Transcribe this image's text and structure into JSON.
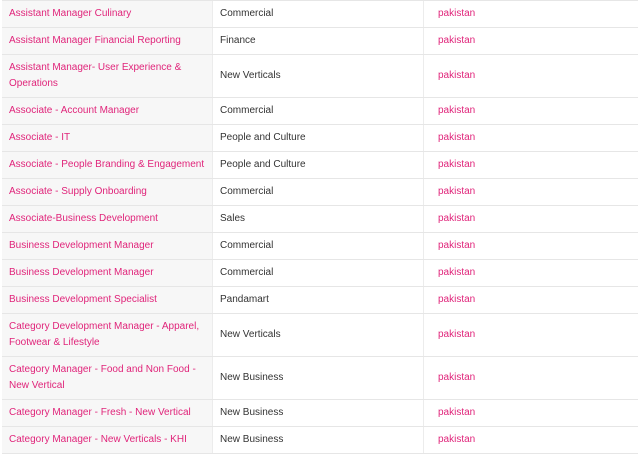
{
  "jobs": [
    {
      "title": "Assistant Manager Culinary",
      "department": "Commercial",
      "location": "pakistan"
    },
    {
      "title": "Assistant Manager Financial Reporting",
      "department": "Finance",
      "location": "pakistan"
    },
    {
      "title": "Assistant Manager- User Experience & Operations",
      "department": "New Verticals",
      "location": "pakistan"
    },
    {
      "title": "Associate - Account Manager",
      "department": "Commercial",
      "location": "pakistan"
    },
    {
      "title": "Associate - IT",
      "department": "People and Culture",
      "location": "pakistan"
    },
    {
      "title": "Associate - People Branding & Engagement",
      "department": "People and Culture",
      "location": "pakistan"
    },
    {
      "title": "Associate - Supply Onboarding",
      "department": "Commercial",
      "location": "pakistan"
    },
    {
      "title": "Associate-Business Development",
      "department": "Sales",
      "location": "pakistan"
    },
    {
      "title": "Business Development Manager",
      "department": "Commercial",
      "location": "pakistan"
    },
    {
      "title": "Business Development Manager",
      "department": "Commercial",
      "location": "pakistan"
    },
    {
      "title": "Business Development Specialist",
      "department": "Pandamart",
      "location": "pakistan"
    },
    {
      "title": "Category Development Manager - Apparel, Footwear & Lifestyle",
      "department": "New Verticals",
      "location": "pakistan"
    },
    {
      "title": "Category Manager - Food and Non Food - New Vertical",
      "department": "New Business",
      "location": "pakistan"
    },
    {
      "title": "Category Manager - Fresh - New Vertical",
      "department": "New Business",
      "location": "pakistan"
    },
    {
      "title": "Category Manager - New Verticals - KHI",
      "department": "New Business",
      "location": "pakistan"
    }
  ],
  "colors": {
    "link": "#e0247a",
    "text": "#333333",
    "title_cell_bg": "#f7f7f7"
  }
}
